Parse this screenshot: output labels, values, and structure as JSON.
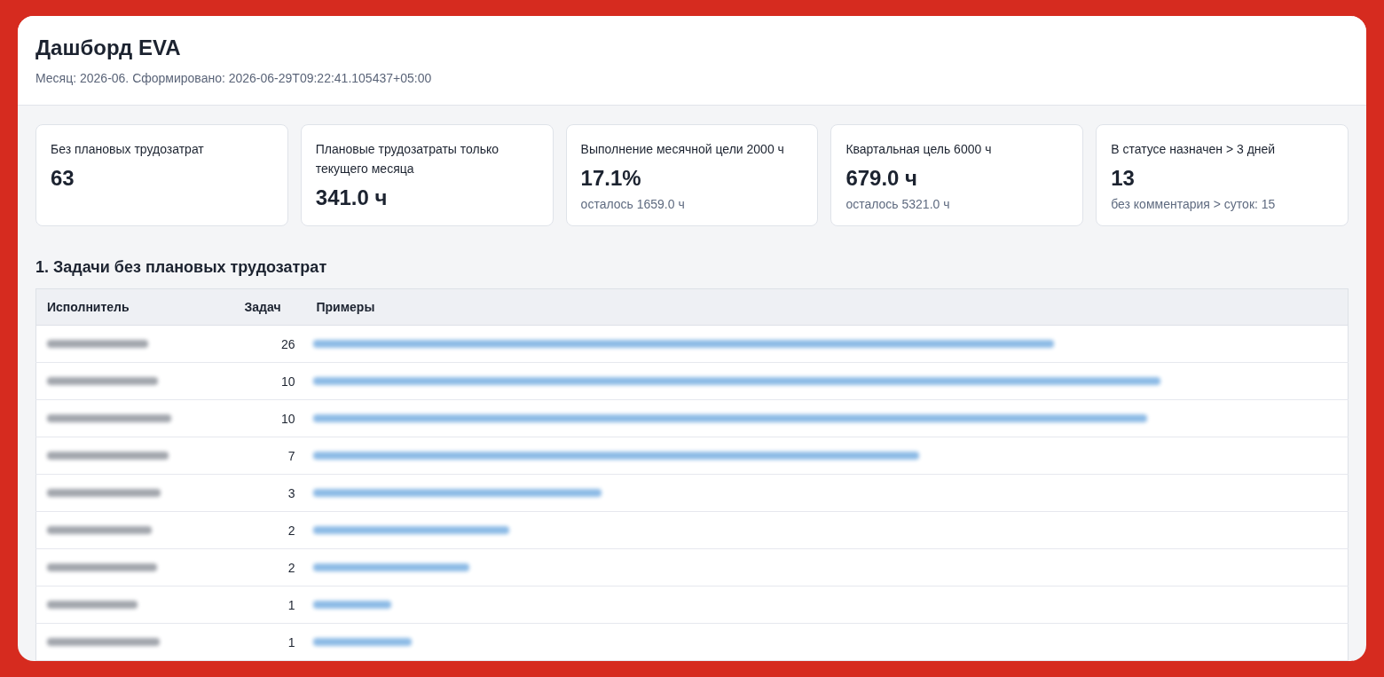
{
  "header": {
    "title": "Дашборд EVA",
    "subtitle": "Месяц: 2026-06. Сформировано: 2026-06-29T09:22:41.105437+05:00"
  },
  "metrics": [
    {
      "label": "Без плановых трудозатрат",
      "value": "63"
    },
    {
      "label": "Плановые трудозатраты только текущего месяца",
      "value": "341.0 ч"
    },
    {
      "label": "Выполнение месячной цели 2000 ч",
      "value": "17.1%",
      "note": "осталось 1659.0 ч"
    },
    {
      "label": "Квартальная цель 6000 ч",
      "value": "679.0 ч",
      "note": "осталось 5321.0 ч"
    },
    {
      "label": "В статусе назначен > 3 дней",
      "value": "13",
      "note": "без комментария > суток: 15"
    }
  ],
  "section": {
    "title": "1. Задачи без плановых трудозатрат",
    "table": {
      "columns": [
        "Исполнитель",
        "Задач",
        "Примеры"
      ],
      "rows": [
        {
          "tasks": "26"
        },
        {
          "tasks": "10"
        },
        {
          "tasks": "10"
        },
        {
          "tasks": "7"
        },
        {
          "tasks": "3"
        },
        {
          "tasks": "2"
        },
        {
          "tasks": "2"
        },
        {
          "tasks": "1"
        },
        {
          "tasks": "1"
        }
      ]
    }
  }
}
